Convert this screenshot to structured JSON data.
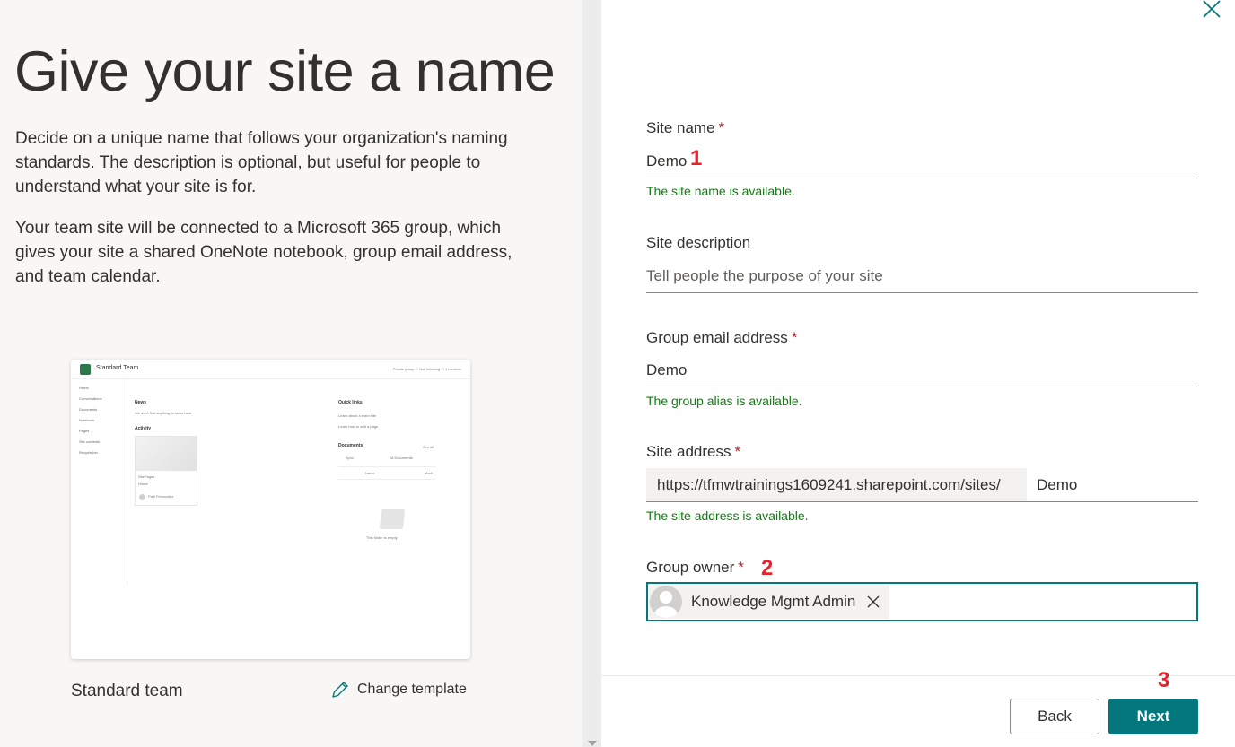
{
  "left": {
    "title": "Give your site a name",
    "description_1": "Decide on a unique name that follows your organization's naming standards. The description is optional, but useful for people to understand what your site is for.",
    "description_2": "Your team site will be connected to a Microsoft 365 group, which gives your site a shared OneNote notebook, group email address, and team calendar.",
    "template_preview": {
      "site_title": "Standard Team",
      "header_meta": "Private group  ☆ Not following  ⚇ 1 member",
      "nav_items": [
        "Home",
        "Conversations",
        "Documents",
        "Notebook",
        "Pages",
        "Site contents",
        "Recycle bin"
      ],
      "news_heading": "News",
      "news_empty": "We don't find anything to show here.",
      "activity_heading": "Activity",
      "activity_card_title": "SitePages",
      "activity_card_sub": "Home",
      "activity_person": "Patti Fernandez",
      "quick_links_heading": "Quick links",
      "quick_link_1": "Learn about a team site",
      "quick_link_2": "Learn how to add a page",
      "documents_heading": "Documents",
      "see_all": "See all",
      "sync": "Sync",
      "all_documents": "All Documents",
      "col_name": "Name",
      "col_modified": "Modi",
      "empty_folder": "This folder is empty"
    },
    "template_name": "Standard team",
    "change_template_label": "Change template"
  },
  "form": {
    "site_name": {
      "label": "Site name",
      "required": "*",
      "value": "Demo",
      "status": "The site name is available."
    },
    "site_description": {
      "label": "Site description",
      "placeholder": "Tell people the purpose of your site"
    },
    "group_email": {
      "label": "Group email address",
      "required": "*",
      "value": "Demo",
      "status": "The group alias is available."
    },
    "site_address": {
      "label": "Site address",
      "required": "*",
      "prefix": "https://tfmwtrainings1609241.sharepoint.com/sites/",
      "value": "Demo",
      "status": "The site address is available."
    },
    "group_owner": {
      "label": "Group owner",
      "required": "*",
      "owner_name": "Knowledge Mgmt Admin"
    }
  },
  "markers": {
    "m1": "1",
    "m2": "2",
    "m3": "3"
  },
  "buttons": {
    "back": "Back",
    "next": "Next"
  },
  "colors": {
    "accent": "#03787c",
    "success": "#107c10",
    "required": "#a4262c",
    "marker": "#e8222c"
  },
  "icons": {
    "close": "close-icon",
    "edit": "pencil-icon",
    "remove": "remove-icon",
    "avatar": "person-avatar-icon"
  }
}
